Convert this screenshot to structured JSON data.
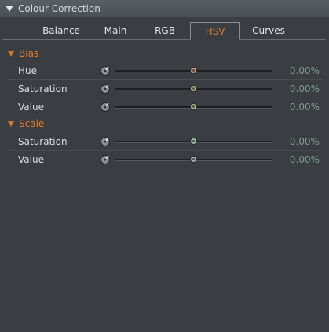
{
  "panel": {
    "title": "Colour Correction"
  },
  "tabs": [
    {
      "label": "Balance"
    },
    {
      "label": "Main"
    },
    {
      "label": "RGB"
    },
    {
      "label": "HSV",
      "active": true
    },
    {
      "label": "Curves"
    }
  ],
  "sections": {
    "bias": {
      "title": "Bias",
      "rows": [
        {
          "label": "Hue",
          "value": "0.00%",
          "slider_position": 0.5,
          "thumb_color": "#c8958a"
        },
        {
          "label": "Saturation",
          "value": "0.00%",
          "slider_position": 0.5,
          "thumb_color": "#c2b88a"
        },
        {
          "label": "Value",
          "value": "0.00%",
          "slider_position": 0.5,
          "thumb_color": "#a9c08e"
        }
      ]
    },
    "scale": {
      "title": "Scale",
      "rows": [
        {
          "label": "Saturation",
          "value": "0.00%",
          "slider_position": 0.5,
          "thumb_color": "#98b89c"
        },
        {
          "label": "Value",
          "value": "0.00%",
          "slider_position": 0.5,
          "thumb_color": "#98b0b0"
        }
      ]
    }
  },
  "colors": {
    "accent": "#e6782a",
    "value_text": "#7f9a8a",
    "background": "#3a3e42"
  },
  "icons": {
    "collapse": "triangle-down-icon",
    "reset": "reset-dial-icon"
  }
}
